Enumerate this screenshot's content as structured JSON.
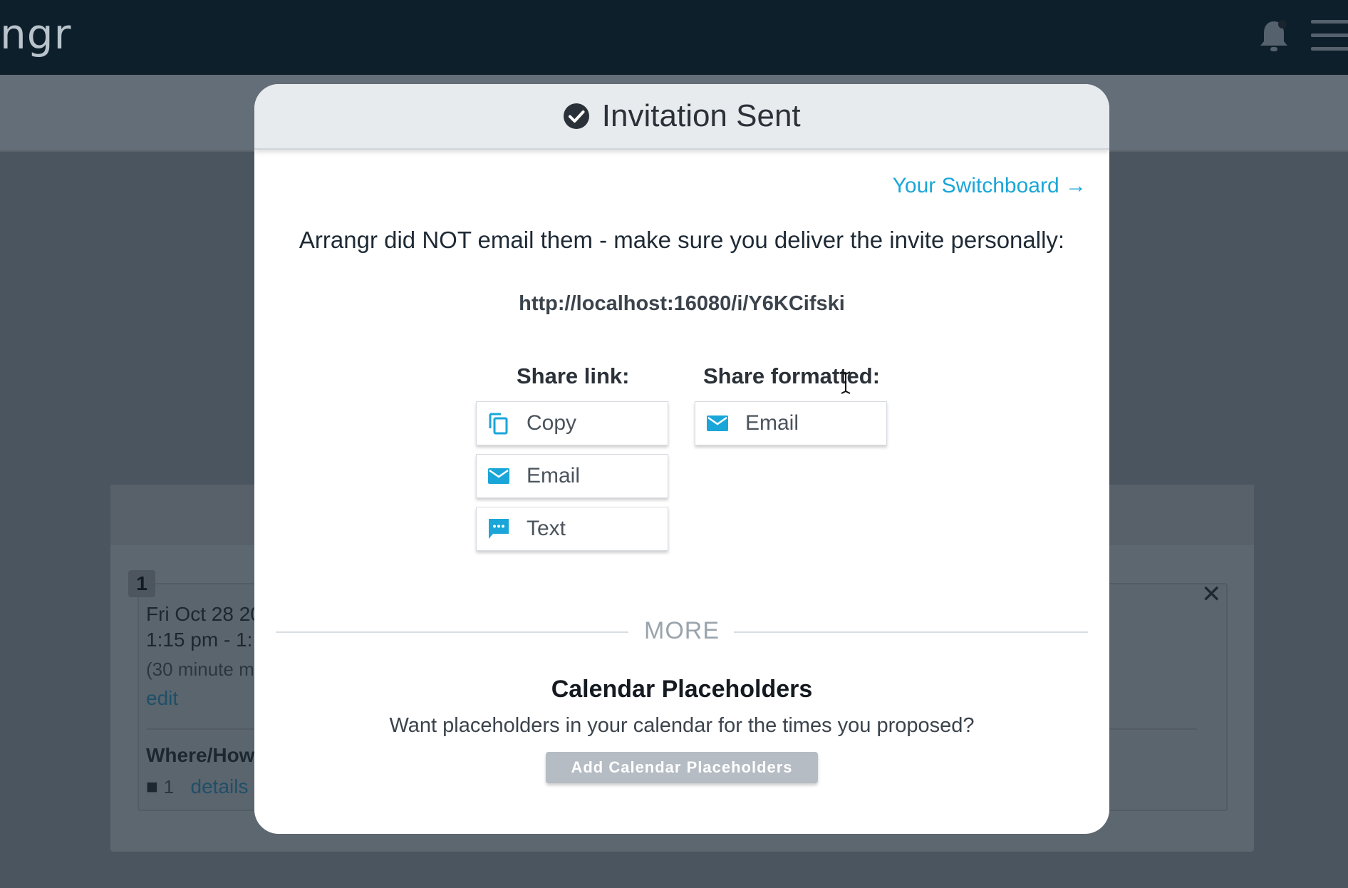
{
  "app": {
    "logo_text": "ngr"
  },
  "background_card": {
    "slot_number": "1",
    "date_line": "Fri Oct 28 20",
    "time_line": "1:15 pm - 1:",
    "duration_line": "(30 minute m",
    "edit_link": "edit",
    "where_label": "Where/How",
    "video_count": "1",
    "details_link": "details"
  },
  "modal": {
    "title": "Invitation Sent",
    "switchboard_link": "Your Switchboard →",
    "notice": "Arrangr did NOT email them - make sure you deliver the invite personally:",
    "invite_url": "http://localhost:16080/i/Y6KCifski",
    "share_link_label": "Share link:",
    "share_formatted_label": "Share formatted:",
    "share_link_buttons": [
      {
        "label": "Copy",
        "icon": "copy-icon"
      },
      {
        "label": "Email",
        "icon": "mail-icon"
      },
      {
        "label": "Text",
        "icon": "chat-icon"
      }
    ],
    "share_formatted_buttons": [
      {
        "label": "Email",
        "icon": "mail-icon"
      }
    ],
    "more_label": "MORE",
    "placeholders_title": "Calendar Placeholders",
    "placeholders_desc": "Want placeholders in your calendar for the times you proposed?",
    "add_placeholders_button": "Add Calendar Placeholders"
  },
  "colors": {
    "accent": "#1aa6d8",
    "header_bg": "#0e1f2c",
    "modal_header_bg": "#e8ebee",
    "disabled_button": "#b5bcc3"
  }
}
